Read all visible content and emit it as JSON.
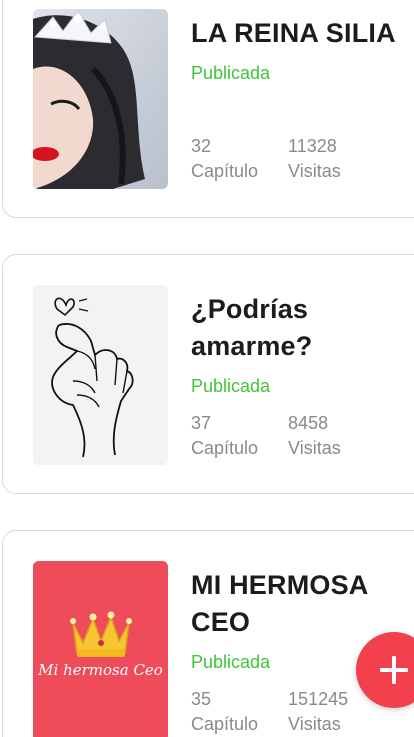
{
  "books": [
    {
      "title": "LA REINA SILIA",
      "status": "Publicada",
      "chapters": "32",
      "chapters_label": "Capítulo",
      "visits": "11328",
      "visits_label": "Visitas",
      "cover_icon": "crowned-woman-illustration"
    },
    {
      "title": "¿Podrías amarme?",
      "status": "Publicada",
      "chapters": "37",
      "chapters_label": "Capítulo",
      "visits": "8458",
      "visits_label": "Visitas",
      "cover_icon": "finger-heart-hand-drawing"
    },
    {
      "title": "MI HERMOSA CEO",
      "status": "Publicada",
      "chapters": "35",
      "chapters_label": "Capítulo",
      "visits": "151245",
      "visits_label": "Visitas",
      "cover_icon": "golden-crown",
      "cover_text": "Mi hermosa Ceo"
    }
  ],
  "fab": {
    "icon": "plus-icon"
  },
  "colors": {
    "status_green": "#3fc53a",
    "fab_red": "#f2404d",
    "cover3_bg": "#ee4c5a"
  }
}
